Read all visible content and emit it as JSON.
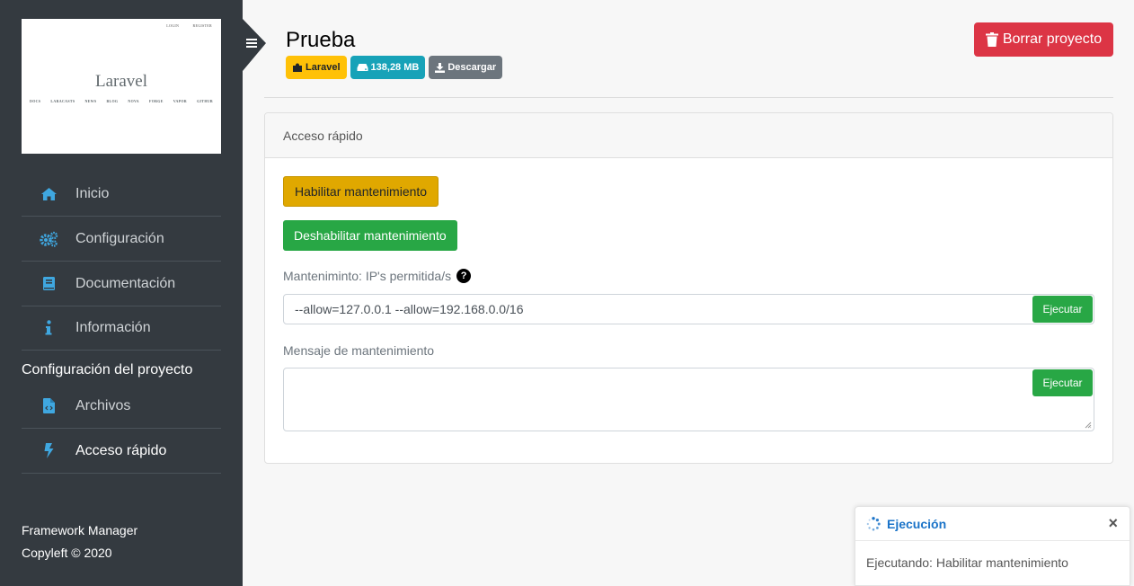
{
  "thumbnail": {
    "top_links": [
      "LOGIN",
      "REGISTER"
    ],
    "title": "Laravel",
    "nav": [
      "DOCS",
      "LARACASTS",
      "NEWS",
      "BLOG",
      "NOVA",
      "FORGE",
      "VAPOR",
      "GITHUB"
    ]
  },
  "sidebar": {
    "items": [
      {
        "label": "Inicio",
        "icon": "home-icon"
      },
      {
        "label": "Configuración",
        "icon": "cogs-icon"
      },
      {
        "label": "Documentación",
        "icon": "book-icon"
      },
      {
        "label": "Información",
        "icon": "info-icon"
      }
    ],
    "section_title": "Configuración del proyecto",
    "project_items": [
      {
        "label": "Archivos",
        "icon": "file-code-icon"
      },
      {
        "label": "Acceso rápido",
        "icon": "bolt-icon"
      }
    ],
    "footer_line1": "Framework Manager",
    "footer_line2": "Copyleft © 2020"
  },
  "header": {
    "title": "Prueba",
    "badges": {
      "framework": "Laravel",
      "size": "138,28 MB",
      "download": "Descargar"
    },
    "delete_button": "Borrar proyecto"
  },
  "card": {
    "header": "Acceso rápido",
    "enable_maintenance": "Habilitar mantenimiento",
    "disable_maintenance": "Deshabilitar mantenimiento",
    "ips_label": "Manteniminto: IP's permitida/s",
    "ips_value": "--allow=127.0.0.1 --allow=192.168.0.0/16",
    "execute_label": "Ejecutar",
    "message_label": "Mensaje de mantenimiento",
    "message_value": ""
  },
  "toast": {
    "title": "Ejecución",
    "close": "×",
    "body": "Ejecutando: Habilitar mantenimiento"
  },
  "colors": {
    "sidebar_bg": "#343a40",
    "icon_blue": "#3fa7e0",
    "danger": "#dc3545",
    "success": "#28a745",
    "warning": "#e0a800",
    "info": "#17a2b8",
    "secondary": "#6c757d"
  }
}
